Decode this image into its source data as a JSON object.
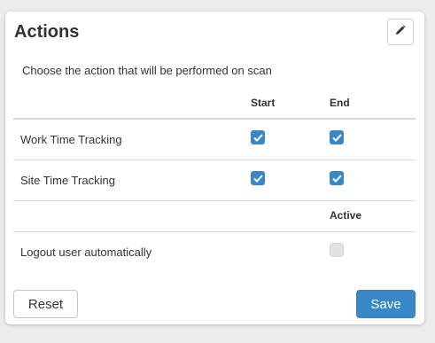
{
  "panel": {
    "title": "Actions",
    "subtitle": "Choose the action that will be performed on scan",
    "edit_icon": "pencil-icon"
  },
  "columns": {
    "start": "Start",
    "end": "End",
    "active": "Active"
  },
  "rows": [
    {
      "label": "Work Time Tracking",
      "start": true,
      "end": true
    },
    {
      "label": "Site Time Tracking",
      "start": true,
      "end": true
    }
  ],
  "logout": {
    "label": "Logout user automatically",
    "active": false,
    "disabled": true
  },
  "buttons": {
    "reset": "Reset",
    "save": "Save"
  },
  "colors": {
    "accent": "#3a87c8",
    "background": "#ededed",
    "card": "#ffffff"
  }
}
